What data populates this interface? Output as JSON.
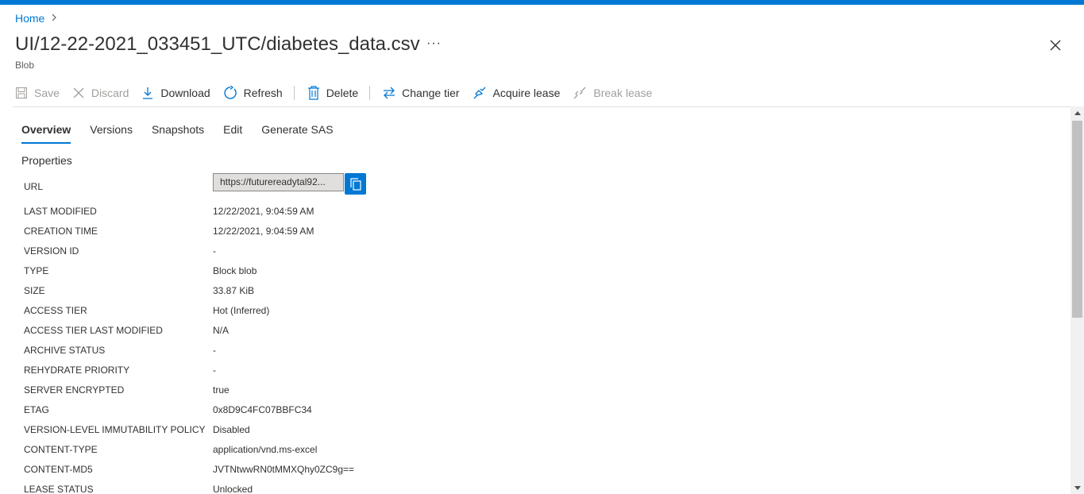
{
  "breadcrumb": {
    "home": "Home"
  },
  "blob": {
    "title": "UI/12-22-2021_033451_UTC/diabetes_data.csv",
    "more": "···",
    "subtitle": "Blob"
  },
  "toolbar": {
    "save": "Save",
    "discard": "Discard",
    "download": "Download",
    "refresh": "Refresh",
    "delete": "Delete",
    "change_tier": "Change tier",
    "acquire_lease": "Acquire lease",
    "break_lease": "Break lease"
  },
  "tabs": [
    "Overview",
    "Versions",
    "Snapshots",
    "Edit",
    "Generate SAS"
  ],
  "properties": {
    "heading": "Properties",
    "url_label": "URL",
    "url_value": "https://futurereadytal92...",
    "rows": [
      {
        "key": "LAST MODIFIED",
        "value": "12/22/2021, 9:04:59 AM"
      },
      {
        "key": "CREATION TIME",
        "value": "12/22/2021, 9:04:59 AM"
      },
      {
        "key": "VERSION ID",
        "value": "-"
      },
      {
        "key": "TYPE",
        "value": "Block blob"
      },
      {
        "key": "SIZE",
        "value": "33.87 KiB"
      },
      {
        "key": "ACCESS TIER",
        "value": "Hot (Inferred)"
      },
      {
        "key": "ACCESS TIER LAST MODIFIED",
        "value": "N/A"
      },
      {
        "key": "ARCHIVE STATUS",
        "value": "-"
      },
      {
        "key": "REHYDRATE PRIORITY",
        "value": "-"
      },
      {
        "key": "SERVER ENCRYPTED",
        "value": "true"
      },
      {
        "key": "ETAG",
        "value": "0x8D9C4FC07BBFC34"
      },
      {
        "key": "VERSION-LEVEL IMMUTABILITY POLICY",
        "value": "Disabled"
      },
      {
        "key": "CONTENT-TYPE",
        "value": "application/vnd.ms-excel"
      },
      {
        "key": "CONTENT-MD5",
        "value": "JVTNtwwRN0tMMXQhy0ZC9g=="
      },
      {
        "key": "LEASE STATUS",
        "value": "Unlocked"
      }
    ]
  },
  "colors": {
    "accent": "#0078d4",
    "text": "#323130",
    "disabled": "#a19f9d"
  }
}
